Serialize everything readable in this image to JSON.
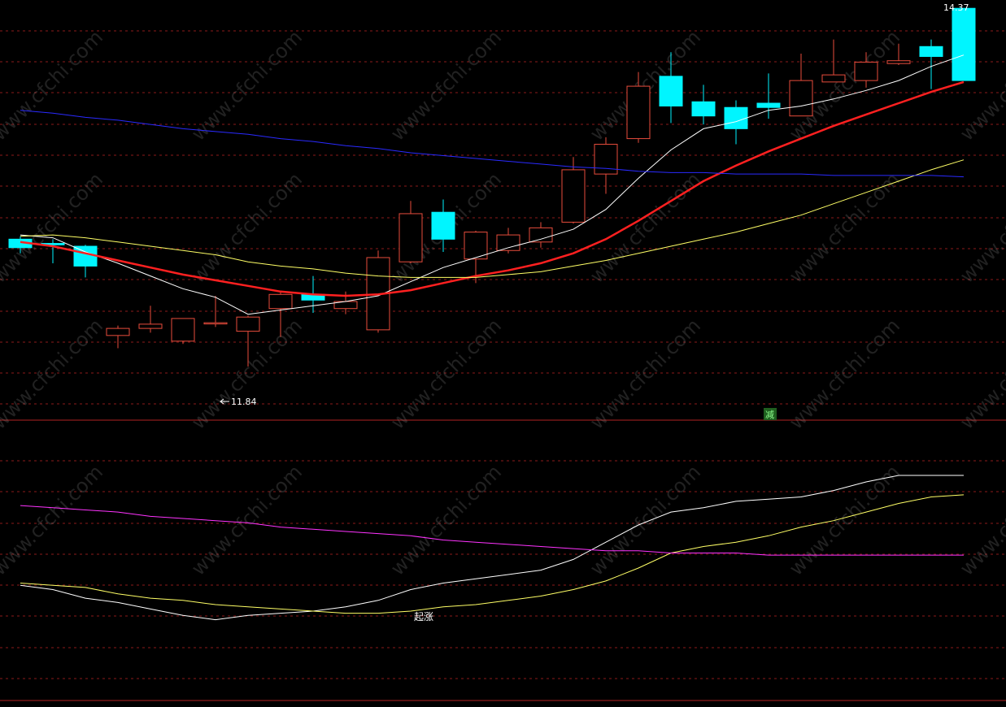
{
  "colors": {
    "background": "#000000",
    "grid": "#8b1a1a",
    "separator": "#b22222",
    "candle_up": "#e74c3c",
    "candle_down": "#00f5ff",
    "ma5": "#ffffff",
    "ma10": "#ff2020",
    "ma20": "#ffff66",
    "ma60": "#2a2aff",
    "ind_fast": "#ffffff",
    "ind_slow": "#ffff66",
    "ind_long": "#ff33ff",
    "label": "#ffffff",
    "marker_bg": "#1f5f1f",
    "marker_fg": "#8fff8f"
  },
  "watermark": "www.cfchi.com",
  "annotations": {
    "high_label": "14.37",
    "low_label": "11.84",
    "rise_label": "起涨",
    "reduce_label": "减"
  },
  "chart_data": [
    {
      "type": "candlestick",
      "panel": "price",
      "ylim": [
        11.6,
        14.4
      ],
      "grid": true,
      "candles": [
        {
          "o": 12.74,
          "h": 12.76,
          "l": 12.64,
          "c": 12.68
        },
        {
          "o": 12.71,
          "h": 12.74,
          "l": 12.57,
          "c": 12.7
        },
        {
          "o": 12.69,
          "h": 12.7,
          "l": 12.47,
          "c": 12.55
        },
        {
          "o": 12.06,
          "h": 12.13,
          "l": 11.97,
          "c": 12.11
        },
        {
          "o": 12.11,
          "h": 12.27,
          "l": 12.08,
          "c": 12.14
        },
        {
          "o": 12.02,
          "h": 12.17,
          "l": 12.0,
          "c": 12.18
        },
        {
          "o": 12.15,
          "h": 12.34,
          "l": 12.12,
          "c": 12.15
        },
        {
          "o": 12.09,
          "h": 12.2,
          "l": 11.84,
          "c": 12.19
        },
        {
          "o": 12.25,
          "h": 12.37,
          "l": 12.05,
          "c": 12.35
        },
        {
          "o": 12.35,
          "h": 12.48,
          "l": 12.22,
          "c": 12.31
        },
        {
          "o": 12.25,
          "h": 12.37,
          "l": 12.21,
          "c": 12.3
        },
        {
          "o": 12.1,
          "h": 12.66,
          "l": 12.08,
          "c": 12.61
        },
        {
          "o": 12.58,
          "h": 13.01,
          "l": 12.57,
          "c": 12.92
        },
        {
          "o": 12.93,
          "h": 13.02,
          "l": 12.65,
          "c": 12.74
        },
        {
          "o": 12.6,
          "h": 12.8,
          "l": 12.43,
          "c": 12.79
        },
        {
          "o": 12.66,
          "h": 12.82,
          "l": 12.64,
          "c": 12.77
        },
        {
          "o": 12.72,
          "h": 12.86,
          "l": 12.68,
          "c": 12.82
        },
        {
          "o": 12.86,
          "h": 13.32,
          "l": 12.85,
          "c": 13.23
        },
        {
          "o": 13.2,
          "h": 13.46,
          "l": 13.06,
          "c": 13.41
        },
        {
          "o": 13.45,
          "h": 13.92,
          "l": 13.42,
          "c": 13.82
        },
        {
          "o": 13.89,
          "h": 14.06,
          "l": 13.56,
          "c": 13.68
        },
        {
          "o": 13.71,
          "h": 13.83,
          "l": 13.55,
          "c": 13.61
        },
        {
          "o": 13.67,
          "h": 13.72,
          "l": 13.41,
          "c": 13.52
        },
        {
          "o": 13.7,
          "h": 13.91,
          "l": 13.59,
          "c": 13.67
        },
        {
          "o": 13.61,
          "h": 14.05,
          "l": 13.61,
          "c": 13.86
        },
        {
          "o": 13.85,
          "h": 14.15,
          "l": 13.85,
          "c": 13.9
        },
        {
          "o": 13.86,
          "h": 14.06,
          "l": 13.81,
          "c": 13.99
        },
        {
          "o": 13.98,
          "h": 14.12,
          "l": 13.97,
          "c": 14.0
        },
        {
          "o": 14.1,
          "h": 14.15,
          "l": 13.8,
          "c": 14.03
        },
        {
          "o": 14.37,
          "h": 14.37,
          "l": 13.86,
          "c": 13.86
        }
      ],
      "series": [
        {
          "key": "ma5",
          "values": [
            12.77,
            12.75,
            12.65,
            12.57,
            12.48,
            12.39,
            12.33,
            12.21,
            12.24,
            12.27,
            12.3,
            12.34,
            12.44,
            12.54,
            12.61,
            12.68,
            12.74,
            12.81,
            12.95,
            13.17,
            13.37,
            13.52,
            13.57,
            13.65,
            13.68,
            13.73,
            13.79,
            13.86,
            13.96,
            14.04
          ]
        },
        {
          "key": "ma10",
          "values": [
            12.72,
            12.69,
            12.64,
            12.59,
            12.54,
            12.49,
            12.45,
            12.41,
            12.37,
            12.35,
            12.34,
            12.35,
            12.38,
            12.43,
            12.48,
            12.52,
            12.57,
            12.64,
            12.74,
            12.87,
            13.01,
            13.15,
            13.26,
            13.36,
            13.45,
            13.54,
            13.62,
            13.7,
            13.78,
            13.85
          ]
        },
        {
          "key": "ma20",
          "values": [
            12.76,
            12.77,
            12.75,
            12.72,
            12.69,
            12.66,
            12.63,
            12.58,
            12.55,
            12.53,
            12.5,
            12.48,
            12.47,
            12.47,
            12.47,
            12.49,
            12.51,
            12.55,
            12.59,
            12.64,
            12.69,
            12.74,
            12.79,
            12.85,
            12.91,
            12.99,
            13.07,
            13.15,
            13.23,
            13.3
          ]
        },
        {
          "key": "ma60",
          "values": [
            13.65,
            13.63,
            13.6,
            13.58,
            13.55,
            13.52,
            13.5,
            13.48,
            13.45,
            13.43,
            13.4,
            13.38,
            13.35,
            13.33,
            13.31,
            13.29,
            13.27,
            13.25,
            13.24,
            13.22,
            13.21,
            13.21,
            13.2,
            13.2,
            13.2,
            13.19,
            13.19,
            13.19,
            13.19,
            13.18
          ]
        }
      ]
    },
    {
      "type": "line",
      "panel": "indicator",
      "ylim": [
        0,
        100
      ],
      "grid": true,
      "series": [
        {
          "key": "ind_fast",
          "values": [
            32,
            30,
            26,
            24,
            21,
            18,
            16,
            18,
            19,
            20,
            22,
            25,
            30,
            33,
            35,
            37,
            39,
            44,
            52,
            60,
            66,
            68,
            71,
            72,
            73,
            76,
            80,
            83,
            83,
            83
          ]
        },
        {
          "key": "ind_slow",
          "values": [
            33,
            32,
            31,
            28,
            26,
            25,
            23,
            22,
            21,
            20,
            19,
            19,
            20,
            22,
            23,
            25,
            27,
            30,
            34,
            40,
            47,
            50,
            52,
            55,
            59,
            62,
            66,
            70,
            73,
            74
          ]
        },
        {
          "key": "ind_long",
          "values": [
            69,
            68,
            67,
            66,
            64,
            63,
            62,
            61,
            59,
            58,
            57,
            56,
            55,
            53,
            52,
            51,
            50,
            49,
            48,
            48,
            47,
            47,
            47,
            46,
            46,
            46,
            46,
            46,
            46,
            46
          ]
        }
      ]
    }
  ]
}
